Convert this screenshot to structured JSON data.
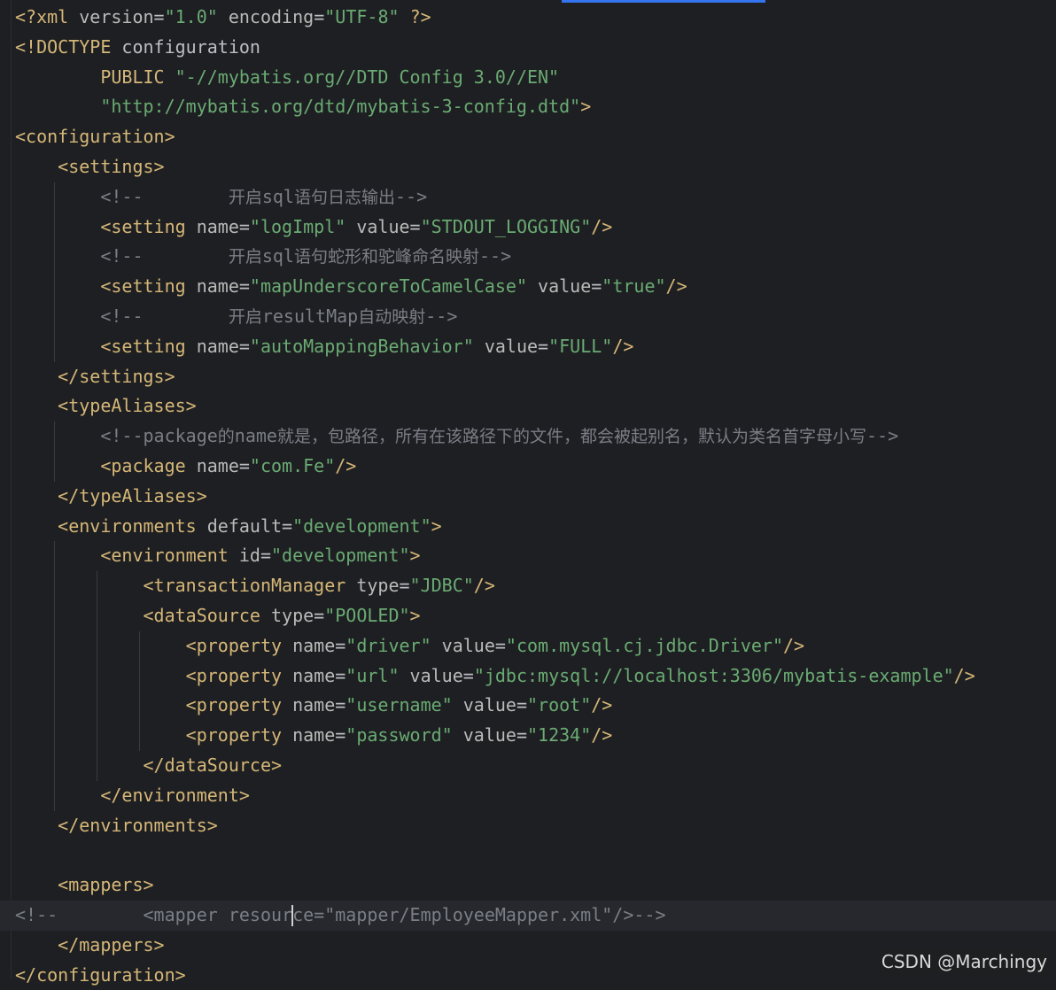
{
  "editor": {
    "theme": {
      "background": "#1e1f22",
      "tag": "#d5b778",
      "attribute": "#bababa",
      "string": "#6aab73",
      "comment": "#7a7e85",
      "accent": "#3574f0"
    },
    "lines": [
      {
        "indent": 0,
        "tokens": [
          {
            "k": "t",
            "v": "<?xml"
          },
          {
            "k": "a",
            "v": " version"
          },
          {
            "k": "p",
            "v": "="
          },
          {
            "k": "s",
            "v": "\"1.0\""
          },
          {
            "k": "a",
            "v": " encoding"
          },
          {
            "k": "p",
            "v": "="
          },
          {
            "k": "s",
            "v": "\"UTF-8\""
          },
          {
            "k": "t",
            "v": " ?>"
          }
        ]
      },
      {
        "indent": 0,
        "tokens": [
          {
            "k": "t",
            "v": "<!DOCTYPE"
          },
          {
            "k": "p",
            "v": " configuration"
          }
        ]
      },
      {
        "indent": 8,
        "tokens": [
          {
            "k": "t",
            "v": "PUBLIC"
          },
          {
            "k": "p",
            "v": " "
          },
          {
            "k": "s",
            "v": "\"-//mybatis.org//DTD Config 3.0//EN\""
          }
        ]
      },
      {
        "indent": 8,
        "tokens": [
          {
            "k": "s",
            "v": "\"http://mybatis.org/dtd/mybatis-3-config.dtd\""
          },
          {
            "k": "t",
            "v": ">"
          }
        ]
      },
      {
        "indent": 0,
        "tokens": [
          {
            "k": "t",
            "v": "<configuration>"
          }
        ]
      },
      {
        "indent": 4,
        "tokens": [
          {
            "k": "t",
            "v": "<settings>"
          }
        ]
      },
      {
        "indent": 8,
        "tokens": [
          {
            "k": "c",
            "v": "<!--        "
          },
          {
            "k": "cz",
            "v": "开启"
          },
          {
            "k": "c",
            "v": "sql"
          },
          {
            "k": "cz",
            "v": "语句日志输出"
          },
          {
            "k": "c",
            "v": "-->"
          }
        ]
      },
      {
        "indent": 8,
        "tokens": [
          {
            "k": "t",
            "v": "<setting"
          },
          {
            "k": "a",
            "v": " name"
          },
          {
            "k": "p",
            "v": "="
          },
          {
            "k": "s",
            "v": "\"logImpl\""
          },
          {
            "k": "a",
            "v": " value"
          },
          {
            "k": "p",
            "v": "="
          },
          {
            "k": "s",
            "v": "\"STDOUT_LOGGING\""
          },
          {
            "k": "t",
            "v": "/>"
          }
        ]
      },
      {
        "indent": 8,
        "tokens": [
          {
            "k": "c",
            "v": "<!--        "
          },
          {
            "k": "cz",
            "v": "开启"
          },
          {
            "k": "c",
            "v": "sql"
          },
          {
            "k": "cz",
            "v": "语句蛇形和驼峰命名映射"
          },
          {
            "k": "c",
            "v": "-->"
          }
        ]
      },
      {
        "indent": 8,
        "tokens": [
          {
            "k": "t",
            "v": "<setting"
          },
          {
            "k": "a",
            "v": " name"
          },
          {
            "k": "p",
            "v": "="
          },
          {
            "k": "s",
            "v": "\"mapUnderscoreToCamelCase\""
          },
          {
            "k": "a",
            "v": " value"
          },
          {
            "k": "p",
            "v": "="
          },
          {
            "k": "s",
            "v": "\"true\""
          },
          {
            "k": "t",
            "v": "/>"
          }
        ]
      },
      {
        "indent": 8,
        "tokens": [
          {
            "k": "c",
            "v": "<!--        "
          },
          {
            "k": "cz",
            "v": "开启"
          },
          {
            "k": "c",
            "v": "resultMap"
          },
          {
            "k": "cz",
            "v": "自动映射"
          },
          {
            "k": "c",
            "v": "-->"
          }
        ]
      },
      {
        "indent": 8,
        "tokens": [
          {
            "k": "t",
            "v": "<setting"
          },
          {
            "k": "a",
            "v": " name"
          },
          {
            "k": "p",
            "v": "="
          },
          {
            "k": "s",
            "v": "\"autoMappingBehavior\""
          },
          {
            "k": "a",
            "v": " value"
          },
          {
            "k": "p",
            "v": "="
          },
          {
            "k": "s",
            "v": "\"FULL\""
          },
          {
            "k": "t",
            "v": "/>"
          }
        ]
      },
      {
        "indent": 4,
        "tokens": [
          {
            "k": "t",
            "v": "</settings>"
          }
        ]
      },
      {
        "indent": 4,
        "tokens": [
          {
            "k": "t",
            "v": "<typeAliases>"
          }
        ]
      },
      {
        "indent": 8,
        "tokens": [
          {
            "k": "c",
            "v": "<!--package"
          },
          {
            "k": "cz",
            "v": "的"
          },
          {
            "k": "c",
            "v": "name"
          },
          {
            "k": "cz",
            "v": "就是，包路径，所有在该路径下的文件，都会被起别名，默认为类名首字母小写"
          },
          {
            "k": "c",
            "v": "-->"
          }
        ]
      },
      {
        "indent": 8,
        "tokens": [
          {
            "k": "t",
            "v": "<package"
          },
          {
            "k": "a",
            "v": " name"
          },
          {
            "k": "p",
            "v": "="
          },
          {
            "k": "s",
            "v": "\"com.Fe\""
          },
          {
            "k": "t",
            "v": "/>"
          }
        ]
      },
      {
        "indent": 4,
        "tokens": [
          {
            "k": "t",
            "v": "</typeAliases>"
          }
        ]
      },
      {
        "indent": 4,
        "tokens": [
          {
            "k": "t",
            "v": "<environments"
          },
          {
            "k": "a",
            "v": " default"
          },
          {
            "k": "p",
            "v": "="
          },
          {
            "k": "s",
            "v": "\"development\""
          },
          {
            "k": "t",
            "v": ">"
          }
        ]
      },
      {
        "indent": 8,
        "tokens": [
          {
            "k": "t",
            "v": "<environment"
          },
          {
            "k": "a",
            "v": " id"
          },
          {
            "k": "p",
            "v": "="
          },
          {
            "k": "s",
            "v": "\"development\""
          },
          {
            "k": "t",
            "v": ">"
          }
        ]
      },
      {
        "indent": 12,
        "tokens": [
          {
            "k": "t",
            "v": "<transactionManager"
          },
          {
            "k": "a",
            "v": " type"
          },
          {
            "k": "p",
            "v": "="
          },
          {
            "k": "s",
            "v": "\"JDBC\""
          },
          {
            "k": "t",
            "v": "/>"
          }
        ]
      },
      {
        "indent": 12,
        "tokens": [
          {
            "k": "t",
            "v": "<dataSource"
          },
          {
            "k": "a",
            "v": " type"
          },
          {
            "k": "p",
            "v": "="
          },
          {
            "k": "s",
            "v": "\"POOLED\""
          },
          {
            "k": "t",
            "v": ">"
          }
        ]
      },
      {
        "indent": 16,
        "tokens": [
          {
            "k": "t",
            "v": "<property"
          },
          {
            "k": "a",
            "v": " name"
          },
          {
            "k": "p",
            "v": "="
          },
          {
            "k": "s",
            "v": "\"driver\""
          },
          {
            "k": "a",
            "v": " value"
          },
          {
            "k": "p",
            "v": "="
          },
          {
            "k": "s",
            "v": "\"com.mysql.cj.jdbc.Driver\""
          },
          {
            "k": "t",
            "v": "/>"
          }
        ]
      },
      {
        "indent": 16,
        "tokens": [
          {
            "k": "t",
            "v": "<property"
          },
          {
            "k": "a",
            "v": " name"
          },
          {
            "k": "p",
            "v": "="
          },
          {
            "k": "s",
            "v": "\"url\""
          },
          {
            "k": "a",
            "v": " value"
          },
          {
            "k": "p",
            "v": "="
          },
          {
            "k": "s",
            "v": "\"jdbc:mysql://localhost:3306/mybatis-example\""
          },
          {
            "k": "t",
            "v": "/>"
          }
        ]
      },
      {
        "indent": 16,
        "tokens": [
          {
            "k": "t",
            "v": "<property"
          },
          {
            "k": "a",
            "v": " name"
          },
          {
            "k": "p",
            "v": "="
          },
          {
            "k": "s",
            "v": "\"username\""
          },
          {
            "k": "a",
            "v": " value"
          },
          {
            "k": "p",
            "v": "="
          },
          {
            "k": "s",
            "v": "\"root\""
          },
          {
            "k": "t",
            "v": "/>"
          }
        ]
      },
      {
        "indent": 16,
        "tokens": [
          {
            "k": "t",
            "v": "<property"
          },
          {
            "k": "a",
            "v": " name"
          },
          {
            "k": "p",
            "v": "="
          },
          {
            "k": "s",
            "v": "\"password\""
          },
          {
            "k": "a",
            "v": " value"
          },
          {
            "k": "p",
            "v": "="
          },
          {
            "k": "s",
            "v": "\"1234\""
          },
          {
            "k": "t",
            "v": "/>"
          }
        ]
      },
      {
        "indent": 12,
        "tokens": [
          {
            "k": "t",
            "v": "</dataSource>"
          }
        ]
      },
      {
        "indent": 8,
        "tokens": [
          {
            "k": "t",
            "v": "</environment>"
          }
        ]
      },
      {
        "indent": 4,
        "tokens": [
          {
            "k": "t",
            "v": "</environments>"
          }
        ]
      },
      {
        "indent": 0,
        "tokens": []
      },
      {
        "indent": 4,
        "tokens": [
          {
            "k": "t",
            "v": "<mappers>"
          }
        ]
      },
      {
        "indent": 0,
        "current": true,
        "tokens": [
          {
            "k": "c",
            "v": "<!--        <mapper resour"
          },
          {
            "k": "caret",
            "v": ""
          },
          {
            "k": "c",
            "v": "ce=\"mapper/EmployeeMapper.xml\"/>-->"
          }
        ]
      },
      {
        "indent": 4,
        "tokens": [
          {
            "k": "t",
            "v": "</mappers>"
          }
        ]
      },
      {
        "indent": 0,
        "tokens": [
          {
            "k": "t",
            "v": "</configuration>"
          }
        ]
      }
    ]
  },
  "watermark": "CSDN @Marchingy"
}
